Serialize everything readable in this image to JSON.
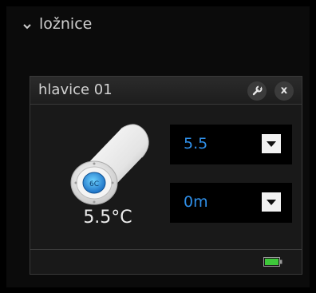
{
  "section": {
    "title": "ložnice",
    "chevron_icon": "chevron-down-icon"
  },
  "device": {
    "title": "hlavice 01",
    "settings_icon": "wrench-icon",
    "close_label": "x",
    "thermostat_icon": "radiator-thermostat-icon",
    "temperature": "5.5°C",
    "setpoint": {
      "value": "5.5"
    },
    "timer": {
      "value": "0m"
    },
    "battery_icon": "battery-full-icon",
    "battery_level": 1.0
  },
  "colors": {
    "accent": "#2f8fe8",
    "battery": "#3ec83a"
  }
}
